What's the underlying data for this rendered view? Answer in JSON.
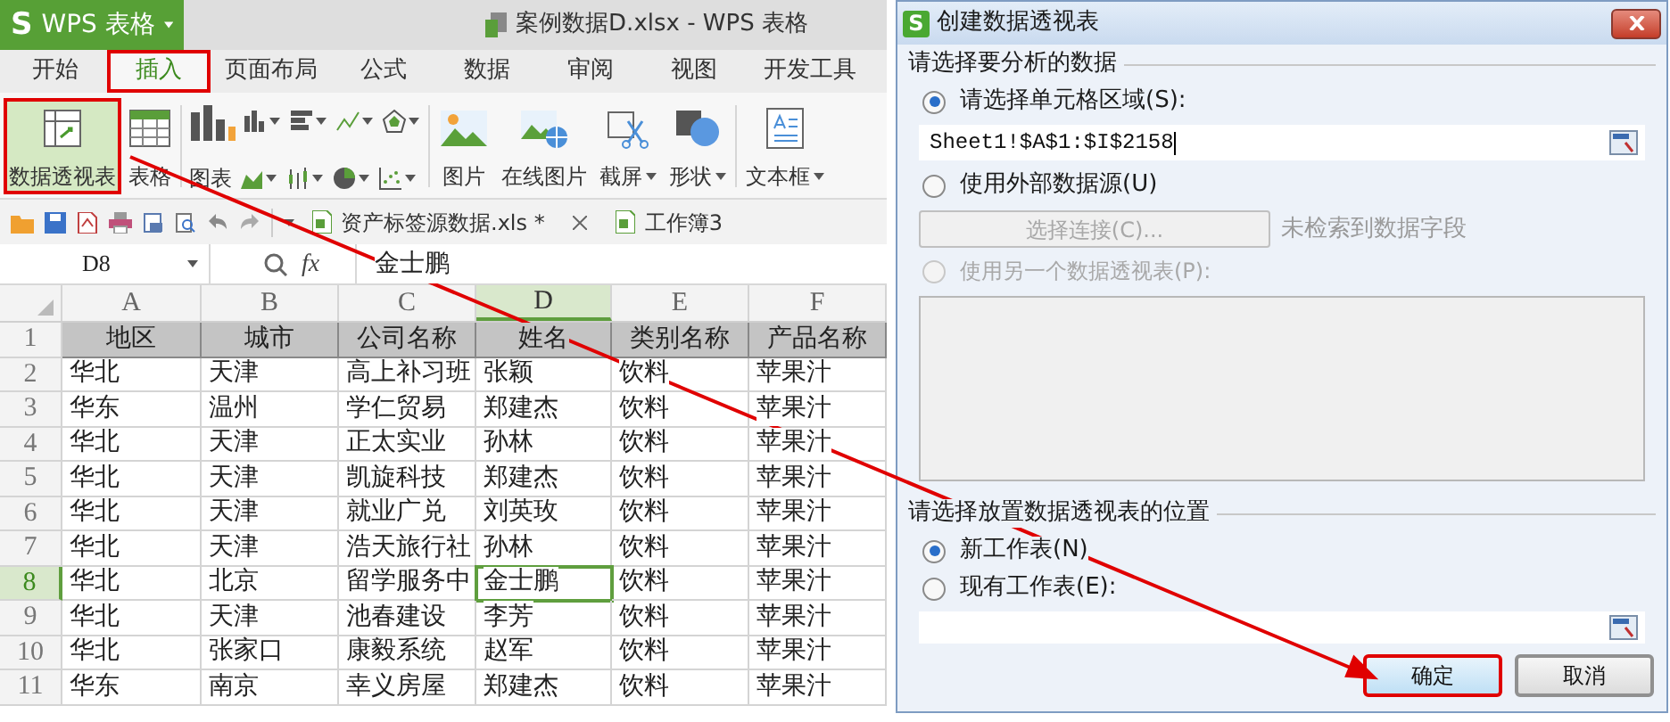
{
  "app_bar": {
    "logo": "S",
    "product": "WPS 表格",
    "document_title": "案例数据D.xlsx - WPS 表格"
  },
  "ribbon_tabs": [
    {
      "label": "开始",
      "selected": false,
      "annotated": false
    },
    {
      "label": "插入",
      "selected": true,
      "annotated": true
    },
    {
      "label": "页面布局",
      "selected": false,
      "annotated": false
    },
    {
      "label": "公式",
      "selected": false,
      "annotated": false
    },
    {
      "label": "数据",
      "selected": false,
      "annotated": false
    },
    {
      "label": "审阅",
      "selected": false,
      "annotated": false
    },
    {
      "label": "视图",
      "selected": false,
      "annotated": false
    },
    {
      "label": "开发工具",
      "selected": false,
      "annotated": false
    }
  ],
  "ribbon": [
    {
      "kind": "pivot",
      "label": "数据透视表",
      "highlighted": true,
      "annotated": true,
      "dropdown": false
    },
    {
      "kind": "table",
      "label": "表格",
      "highlighted": false,
      "annotated": false,
      "dropdown": false
    },
    {
      "kind": "charts",
      "label": "图表",
      "highlighted": false,
      "annotated": false,
      "dropdown": false
    },
    {
      "kind": "picture",
      "label": "图片",
      "highlighted": false,
      "annotated": false,
      "dropdown": false
    },
    {
      "kind": "online-picture",
      "label": "在线图片",
      "highlighted": false,
      "annotated": false,
      "dropdown": false
    },
    {
      "kind": "screenshot",
      "label": "截屏",
      "highlighted": false,
      "annotated": false,
      "dropdown": true
    },
    {
      "kind": "shape",
      "label": "形状",
      "highlighted": false,
      "annotated": false,
      "dropdown": true
    },
    {
      "kind": "textbox",
      "label": "文本框",
      "highlighted": false,
      "annotated": false,
      "dropdown": true
    }
  ],
  "file_tabs": [
    {
      "label": "资产标签源数据.xls *",
      "selected": false
    },
    {
      "label": "工作簿3",
      "selected": false
    }
  ],
  "formula_bar": {
    "cell_ref": "D8",
    "fx": "fx",
    "value": "金士鹏"
  },
  "sheet": {
    "columns": [
      {
        "label": "A",
        "selected": false
      },
      {
        "label": "B",
        "selected": false
      },
      {
        "label": "C",
        "selected": false
      },
      {
        "label": "D",
        "selected": true
      },
      {
        "label": "E",
        "selected": false
      },
      {
        "label": "F",
        "selected": false
      }
    ],
    "rows": [
      {
        "number": "1",
        "kind": "header",
        "selected": false,
        "cells": [
          "地区",
          "城市",
          "公司名称",
          "姓名",
          "类别名称",
          "产品名称"
        ]
      },
      {
        "number": "2",
        "kind": "data",
        "selected": false,
        "cells": [
          "华北",
          "天津",
          "高上补习班",
          "张颖",
          "饮料",
          "苹果汁"
        ]
      },
      {
        "number": "3",
        "kind": "data",
        "selected": false,
        "cells": [
          "华东",
          "温州",
          "学仁贸易",
          "郑建杰",
          "饮料",
          "苹果汁"
        ]
      },
      {
        "number": "4",
        "kind": "data",
        "selected": false,
        "cells": [
          "华北",
          "天津",
          "正太实业",
          "孙林",
          "饮料",
          "苹果汁"
        ]
      },
      {
        "number": "5",
        "kind": "data",
        "selected": false,
        "cells": [
          "华北",
          "天津",
          "凯旋科技",
          "郑建杰",
          "饮料",
          "苹果汁"
        ]
      },
      {
        "number": "6",
        "kind": "data",
        "selected": false,
        "cells": [
          "华北",
          "天津",
          "就业广兑",
          "刘英玫",
          "饮料",
          "苹果汁"
        ]
      },
      {
        "number": "7",
        "kind": "data",
        "selected": false,
        "cells": [
          "华北",
          "天津",
          "浩天旅行社",
          "孙林",
          "饮料",
          "苹果汁"
        ]
      },
      {
        "number": "8",
        "kind": "data",
        "selected": true,
        "cells": [
          "华北",
          "北京",
          "留学服务中",
          "金士鹏",
          "饮料",
          "苹果汁"
        ]
      },
      {
        "number": "9",
        "kind": "data",
        "selected": false,
        "cells": [
          "华北",
          "天津",
          "池春建设",
          "李芳",
          "饮料",
          "苹果汁"
        ]
      },
      {
        "number": "10",
        "kind": "data",
        "selected": false,
        "cells": [
          "华北",
          "张家口",
          "康毅系统",
          "赵军",
          "饮料",
          "苹果汁"
        ]
      },
      {
        "number": "11",
        "kind": "data",
        "selected": false,
        "cells": [
          "华东",
          "南京",
          "幸义房屋",
          "郑建杰",
          "饮料",
          "苹果汁"
        ]
      }
    ]
  },
  "dialog": {
    "logo": "S",
    "title": "创建数据透视表",
    "source": {
      "heading": "请选择要分析的数据",
      "range_option": {
        "label": "请选择单元格区域(S):",
        "selected": true,
        "value": "Sheet1!$A$1:$I$2158"
      },
      "external_option": {
        "label": "使用外部数据源(U)",
        "selected": false
      },
      "connect_button": {
        "label": "选择连接(C)...",
        "disabled": true
      },
      "status": "未检索到数据字段",
      "pivot_option": {
        "label": "使用另一个数据透视表(P):",
        "selected": false,
        "disabled": true
      }
    },
    "placement": {
      "heading": "请选择放置数据透视表的位置",
      "options": [
        {
          "label": "新工作表(N)",
          "selected": true
        },
        {
          "label": "现有工作表(E):",
          "selected": false
        }
      ]
    },
    "buttons": [
      {
        "label": "确定",
        "default": true,
        "annotated": true
      },
      {
        "label": "取消",
        "default": false,
        "annotated": false
      }
    ]
  }
}
